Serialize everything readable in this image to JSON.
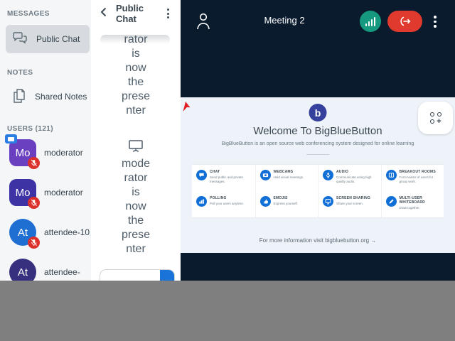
{
  "colors": {
    "navy": "#0a1b2e",
    "teal_connection": "#15997f",
    "leave_red": "#e0392e",
    "muted_badge_red": "#dc312a",
    "accent_blue": "#0f6fd7",
    "send_blue": "#1a73d9",
    "gray_band": "#7f7f7f",
    "presentation_bg": "#eef3f9",
    "logo_blue": "#35419c",
    "sidebar_bg": "#f4f6f8",
    "selected_item_bg": "#d7dbdf"
  },
  "sidebar": {
    "messages_header": "MESSAGES",
    "public_chat_label": "Public Chat",
    "notes_header": "NOTES",
    "shared_notes_label": "Shared Notes",
    "users_header": "USERS (121)",
    "users": [
      {
        "initials": "Mo",
        "name": "moderator",
        "color": "#6a3fc0"
      },
      {
        "initials": "Mo",
        "name": "moderator",
        "color": "#3d33a5"
      },
      {
        "initials": "At",
        "name": "attendee-10",
        "color": "#1f6fd2"
      },
      {
        "initials": "At",
        "name": "attendee-",
        "color": "#37307f"
      }
    ]
  },
  "chat": {
    "title": "Public Chat",
    "message1_lines": [
      "rator",
      "is",
      "now",
      "the",
      "prese",
      "nter"
    ],
    "message2_lines": [
      "mode",
      "rator",
      "is",
      "now",
      "the",
      "prese",
      "nter"
    ]
  },
  "topbar": {
    "title": "Meeting 2"
  },
  "presentation": {
    "logo_letter": "b",
    "welcome_title": "Welcome To BigBlueButton",
    "welcome_subtitle": "BigBlueButton is an open source web conferencing system designed for online learning",
    "features": [
      {
        "name": "CHAT",
        "desc": "Send public and private messages."
      },
      {
        "name": "WEBCAMS",
        "desc": "Hold visual meetings."
      },
      {
        "name": "AUDIO",
        "desc": "Communicate using high quality audio."
      },
      {
        "name": "BREAKOUT ROOMS",
        "desc": "Form teams of users for group work."
      },
      {
        "name": "POLLING",
        "desc": "Poll your users anytime."
      },
      {
        "name": "EMOJIS",
        "desc": "Express yourself."
      },
      {
        "name": "SCREEN SHARING",
        "desc": "Share your screen."
      },
      {
        "name": "MULTI-USER WHITEBOARD",
        "desc": "Draw together."
      }
    ],
    "footer": "For more information visit bigbluebutton.org →"
  }
}
